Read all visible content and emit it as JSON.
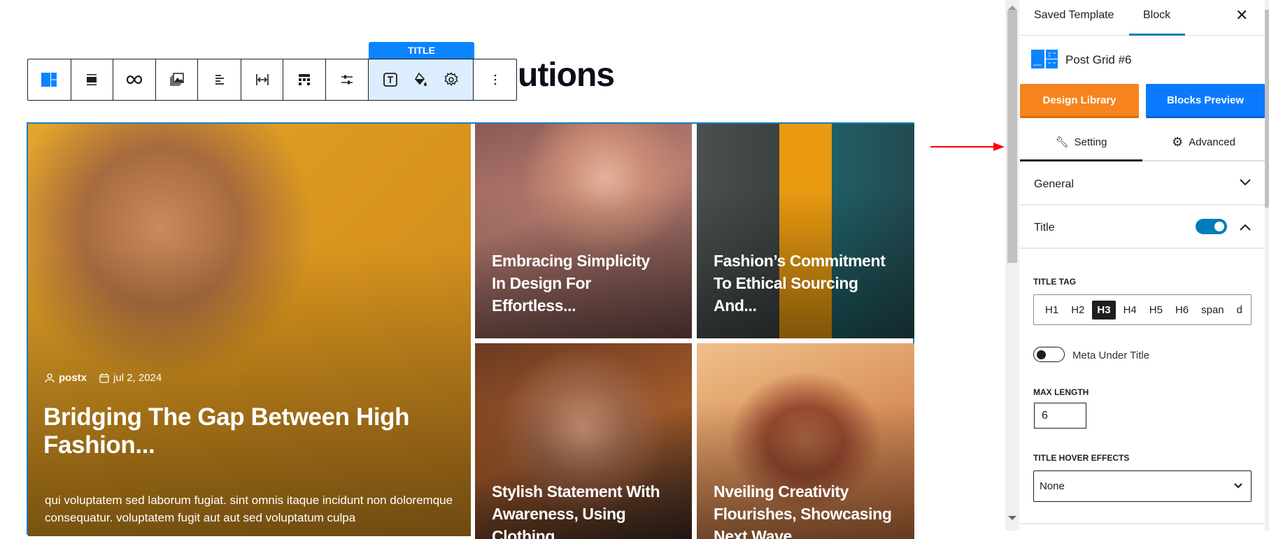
{
  "canvas": {
    "heading_visible": "utions",
    "toolbar": {
      "group_label": "TITLE",
      "buttons": [
        "post-grid-block",
        "align",
        "link",
        "media",
        "text-align",
        "width",
        "layout",
        "settings-sliders",
        "title-typography",
        "title-color",
        "title-settings",
        "more-options"
      ]
    },
    "posts": [
      {
        "title": "Bridging The Gap Between High\nFashion...",
        "author": "postx",
        "date": "jul 2, 2024",
        "excerpt": "qui voluptatem sed laborum fugiat. sint omnis itaque incidunt non doloremque consequatur. voluptatem fugit aut aut sed voluptatum culpa"
      },
      {
        "title": "Embracing Simplicity\nIn Design For\nEffortless..."
      },
      {
        "title": "Fashion’s Commitment\nTo Ethical Sourcing\nAnd..."
      },
      {
        "title": "Stylish Statement With\nAwareness, Using\nClothing..."
      },
      {
        "title": "Nveiling Creativity\nFlourishes, Showcasing\nNext Wave..."
      }
    ]
  },
  "sidebar": {
    "tabs": [
      {
        "label": "Saved Template"
      },
      {
        "label": "Block",
        "active": true
      }
    ],
    "block_name": "Post Grid #6",
    "design_library": "Design Library",
    "blocks_preview": "Blocks Preview",
    "setting_tab": "Setting",
    "advanced_tab": "Advanced",
    "general": "General",
    "title_section": "Title",
    "title_enabled": true,
    "title_tag_label": "TITLE TAG",
    "title_tags": [
      "H1",
      "H2",
      "H3",
      "H4",
      "H5",
      "H6",
      "span",
      "d"
    ],
    "title_tag_selected": "H3",
    "meta_under_title": "Meta Under Title",
    "meta_under_title_enabled": false,
    "max_length_label": "MAX LENGTH",
    "max_length_value": "6",
    "hover_label": "TITLE HOVER EFFECTS",
    "hover_value": "None"
  },
  "colors": {
    "accent": "#0a84ff",
    "orange": "#f7841e",
    "toggle": "#007cba",
    "highlight": "#ff0000"
  }
}
